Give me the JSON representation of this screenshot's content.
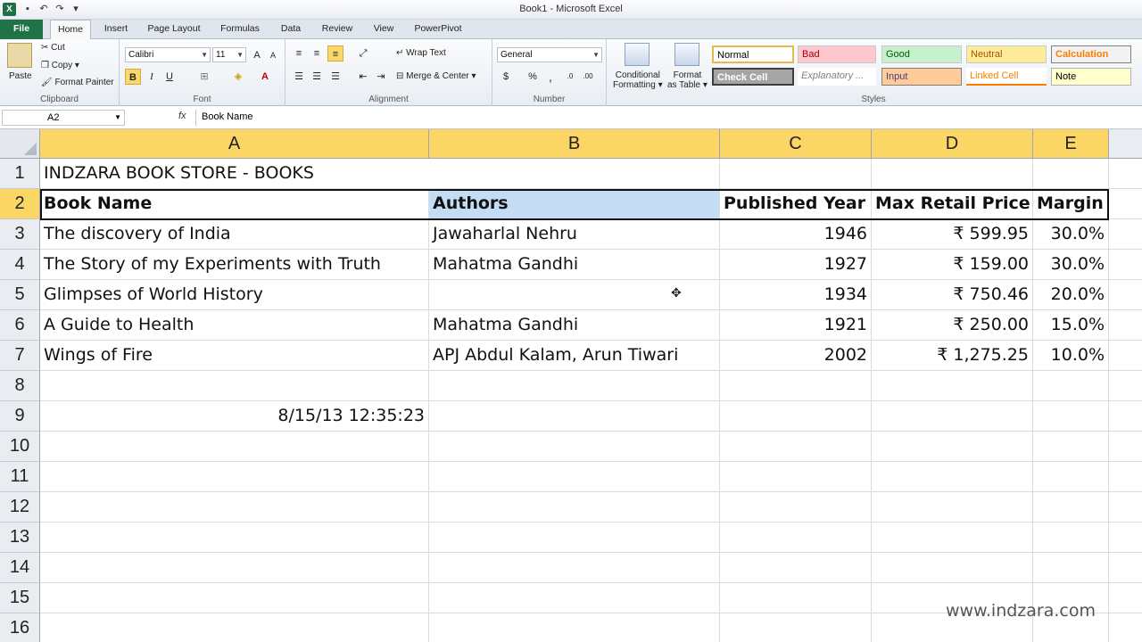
{
  "window": {
    "title": "Book1 - Microsoft Excel",
    "app_icon": "X"
  },
  "tabs": [
    {
      "label": "File"
    },
    {
      "label": "Home"
    },
    {
      "label": "Insert"
    },
    {
      "label": "Page Layout"
    },
    {
      "label": "Formulas"
    },
    {
      "label": "Data"
    },
    {
      "label": "Review"
    },
    {
      "label": "View"
    },
    {
      "label": "PowerPivot"
    }
  ],
  "ribbon": {
    "clipboard": {
      "paste": "Paste",
      "cut": "Cut",
      "copy": "Copy",
      "format_painter": "Format Painter",
      "label": "Clipboard"
    },
    "font": {
      "name": "Calibri",
      "size": "11",
      "label": "Font"
    },
    "alignment": {
      "wrap_text": "Wrap Text",
      "merge_center": "Merge & Center",
      "label": "Alignment"
    },
    "number": {
      "format": "General",
      "label": "Number"
    },
    "conditional_formatting": {
      "line1": "Conditional",
      "line2": "Formatting"
    },
    "format_as_table": {
      "line1": "Format",
      "line2": "as Table"
    },
    "styles": {
      "label": "Styles",
      "items": [
        {
          "label": "Normal",
          "bg": "#ffffff",
          "fg": "#000000"
        },
        {
          "label": "Bad",
          "bg": "#ffc7ce",
          "fg": "#9c0006"
        },
        {
          "label": "Good",
          "bg": "#c6efce",
          "fg": "#006100"
        },
        {
          "label": "Neutral",
          "bg": "#ffeb9c",
          "fg": "#9c5700"
        },
        {
          "label": "Calculation",
          "bg": "#f2f2f2",
          "fg": "#fa7d00"
        },
        {
          "label": "Check Cell",
          "bg": "#a5a5a5",
          "fg": "#ffffff"
        },
        {
          "label": "Explanatory ...",
          "bg": "#ffffff",
          "fg": "#7f7f7f"
        },
        {
          "label": "Input",
          "bg": "#ffcc99",
          "fg": "#3f3f76"
        },
        {
          "label": "Linked Cell",
          "bg": "#ffffff",
          "fg": "#fa7d00"
        },
        {
          "label": "Note",
          "bg": "#ffffcc",
          "fg": "#000000"
        }
      ]
    }
  },
  "formula_bar": {
    "name_box": "A2",
    "fx": "fx",
    "content": "Book Name"
  },
  "grid": {
    "columns": [
      "A",
      "B",
      "C",
      "D",
      "E"
    ],
    "rows": [
      "1",
      "2",
      "3",
      "4",
      "5",
      "6",
      "7",
      "8",
      "9",
      "10",
      "11",
      "12",
      "13",
      "14",
      "15",
      "16"
    ],
    "cells": {
      "r1": [
        "INDZARA BOOK STORE - BOOKS",
        "",
        "",
        "",
        ""
      ],
      "r2": [
        "Book Name",
        "Authors",
        "Published Year",
        "Max Retail Price",
        "Margin"
      ],
      "r3": [
        "The discovery of India",
        "Jawaharlal Nehru",
        "1946",
        "₹ 599.95",
        "30.0%"
      ],
      "r4": [
        "The Story of my Experiments with Truth",
        "Mahatma Gandhi",
        "1927",
        "₹ 159.00",
        "30.0%"
      ],
      "r5": [
        "Glimpses of World History",
        "",
        "1934",
        "₹ 750.46",
        "20.0%"
      ],
      "r6": [
        "A Guide to Health",
        "Mahatma Gandhi",
        "1921",
        "₹ 250.00",
        "15.0%"
      ],
      "r7": [
        "Wings of Fire",
        "APJ Abdul Kalam, Arun Tiwari",
        "2002",
        "₹ 1,275.25",
        "10.0%"
      ],
      "r9": [
        "8/15/13 12:35:23",
        "",
        "",
        "",
        ""
      ]
    }
  },
  "watermark": "www.indzara.com"
}
